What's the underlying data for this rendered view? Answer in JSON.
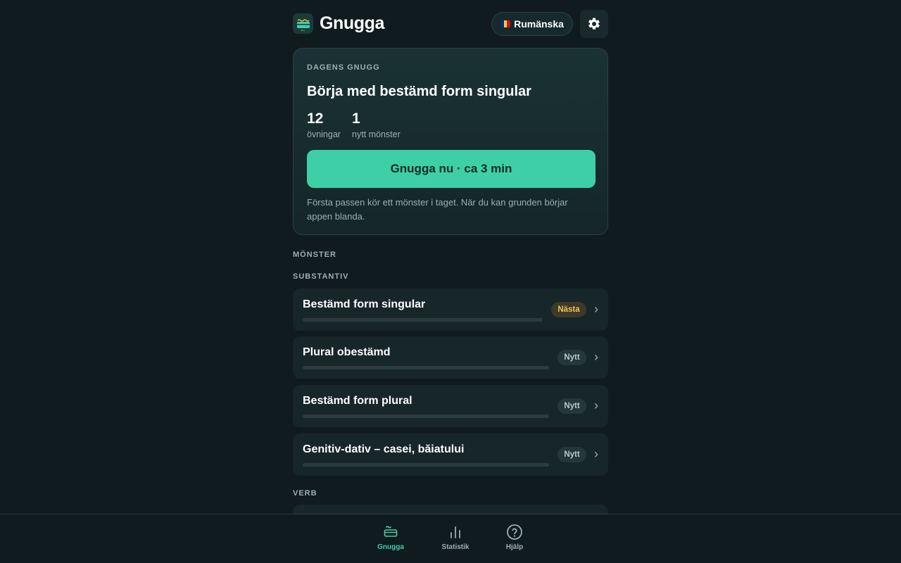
{
  "app": {
    "title": "Gnugga"
  },
  "header": {
    "language_label": "Rumänska",
    "flag_colors": [
      "#002B7F",
      "#FCD116",
      "#CE1126"
    ]
  },
  "today": {
    "kicker": "DAGENS GNUGG",
    "title": "Börja med bestämd form singular",
    "stats": [
      {
        "value": "12",
        "label": "övningar"
      },
      {
        "value": "1",
        "label": "nytt mönster"
      }
    ],
    "cta_label": "Gnugga nu · ca 3 min",
    "note": "Första passen kör ett mönster i taget. När du kan grunden börjar appen blanda."
  },
  "patterns": {
    "heading": "MÖNSTER",
    "groups": [
      {
        "label": "SUBSTANTIV",
        "items": [
          {
            "name": "Bestämd form singular",
            "badge": "Nästa",
            "badge_kind": "next",
            "progress": 0
          },
          {
            "name": "Plural obestämd",
            "badge": "Nytt",
            "badge_kind": "new",
            "progress": 0
          },
          {
            "name": "Bestämd form plural",
            "badge": "Nytt",
            "badge_kind": "new",
            "progress": 0
          },
          {
            "name": "Genitiv-dativ – casei, băiatului",
            "badge": "Nytt",
            "badge_kind": "new",
            "progress": 0
          }
        ]
      },
      {
        "label": "VERB",
        "items": []
      }
    ]
  },
  "nav": {
    "items": [
      {
        "label": "Gnugga",
        "icon": "gnugga-icon",
        "active": true
      },
      {
        "label": "Statistik",
        "icon": "bar-chart-icon",
        "active": false
      },
      {
        "label": "Hjälp",
        "icon": "help-icon",
        "active": false
      }
    ]
  },
  "colors": {
    "accent": "#3ecfa6",
    "next_badge": "#f2c14e",
    "background": "#101b1f"
  }
}
